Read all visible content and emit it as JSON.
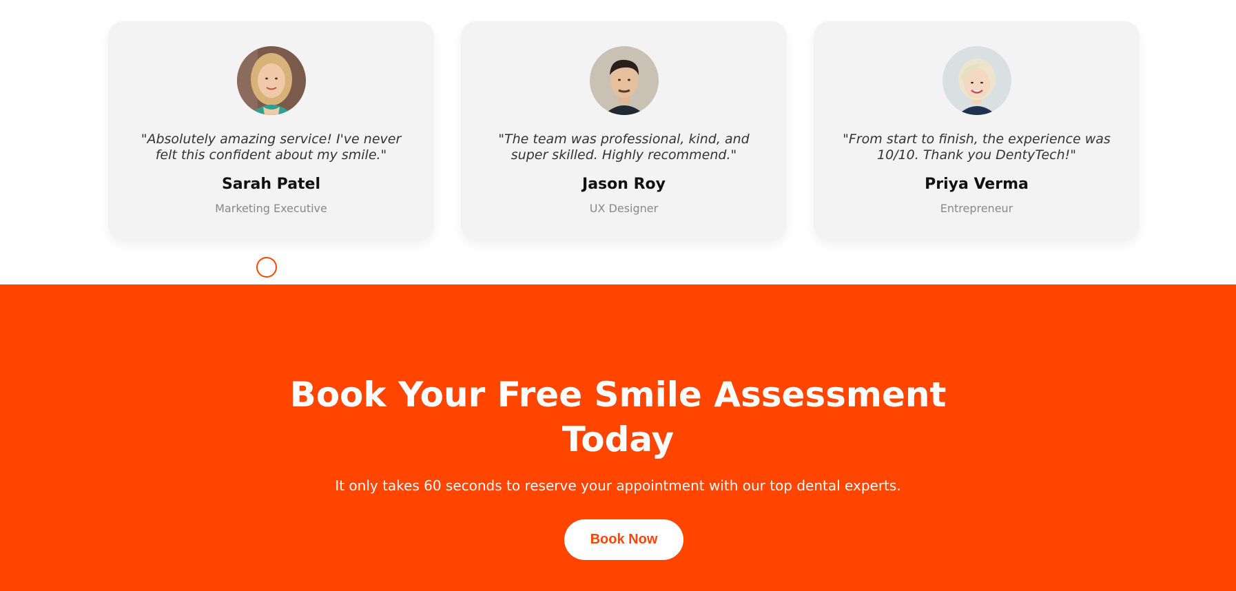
{
  "testimonials": [
    {
      "avatar_icon": "avatar-woman-blonde-icon",
      "quote": "\"Absolutely amazing service! I've never felt this confident about my smile.\"",
      "name": "Sarah Patel",
      "role": "Marketing Executive"
    },
    {
      "avatar_icon": "avatar-man-dark-hair-icon",
      "quote": "\"The team was professional, kind, and super skilled. Highly recommend.\"",
      "name": "Jason Roy",
      "role": "UX Designer"
    },
    {
      "avatar_icon": "avatar-woman-short-hair-icon",
      "quote": "\"From start to finish, the experience was 10/10. Thank you DentyTech!\"",
      "name": "Priya Verma",
      "role": "Entrepreneur"
    }
  ],
  "slider": {
    "active_index": 0
  },
  "cta": {
    "title": "Book Your Free Smile Assessment Today",
    "subtitle": "It only takes 60 seconds to reserve your appointment with our top dental experts.",
    "button_label": "Book Now"
  },
  "colors": {
    "accent": "#ff4500",
    "card_bg": "#f3f3f3",
    "text_dark": "#111111",
    "text_muted": "#888888"
  }
}
